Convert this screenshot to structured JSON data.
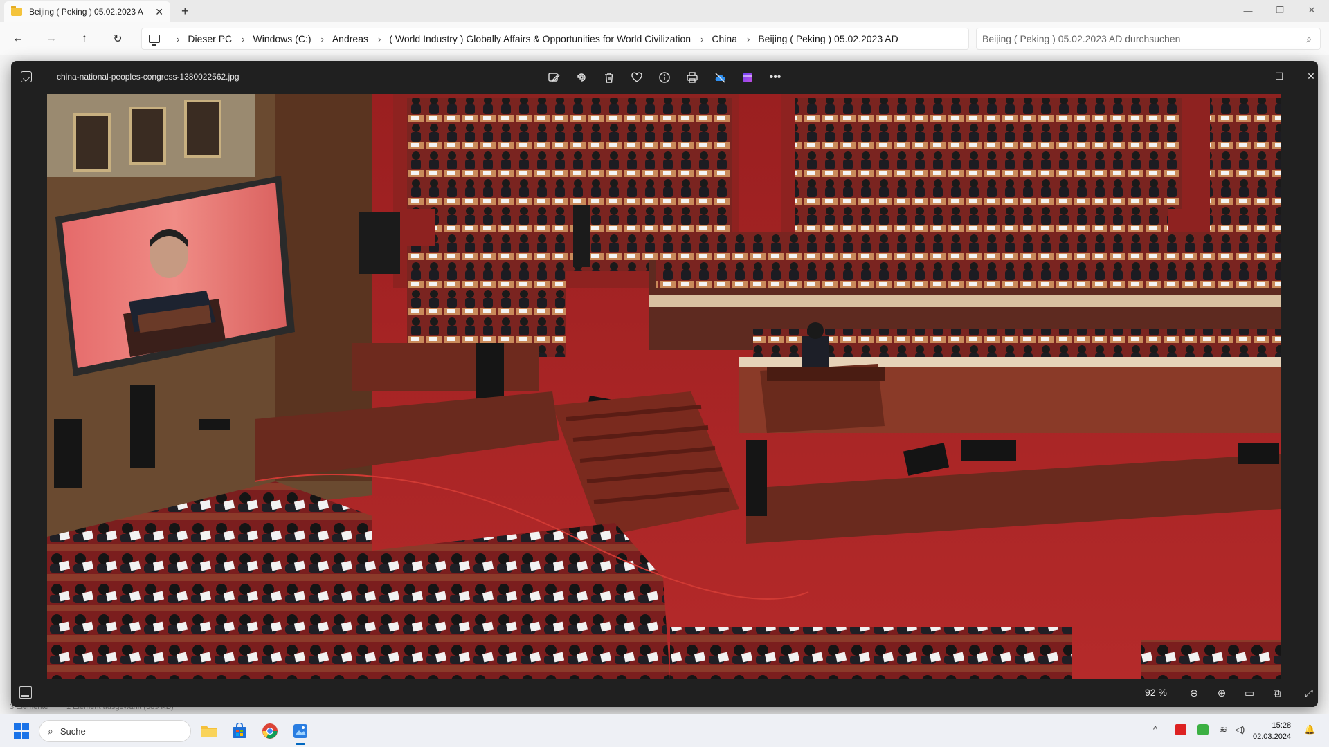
{
  "explorer": {
    "tab_title": "Beijing ( Peking ) 05.02.2023 A",
    "breadcrumbs": [
      "Dieser PC",
      "Windows (C:)",
      "Andreas",
      "( World Industry ) Globally Affairs & Opportunities for World Civilization",
      "China",
      "Beijing ( Peking ) 05.02.2023 AD"
    ],
    "search_placeholder": "Beijing ( Peking ) 05.02.2023 AD durchsuchen",
    "status_left": "3 Elemente",
    "status_mid": "1 Element ausgewählt (389 KB)"
  },
  "photos": {
    "filename": "china-national-peoples-congress-1380022562.jpg",
    "toolbar_icons": [
      "edit-image-icon",
      "rotate-icon",
      "delete-icon",
      "favorite-icon",
      "info-icon",
      "print-icon",
      "onedrive-icon",
      "clipchamp-icon",
      "more-icon"
    ],
    "zoom_label": "92 %"
  },
  "taskbar": {
    "search_label": "Suche",
    "apps": [
      "file-explorer-icon",
      "microsoft-store-icon",
      "chrome-icon",
      "photos-app-icon"
    ],
    "time": "15:28",
    "date": "02.03.2024"
  }
}
